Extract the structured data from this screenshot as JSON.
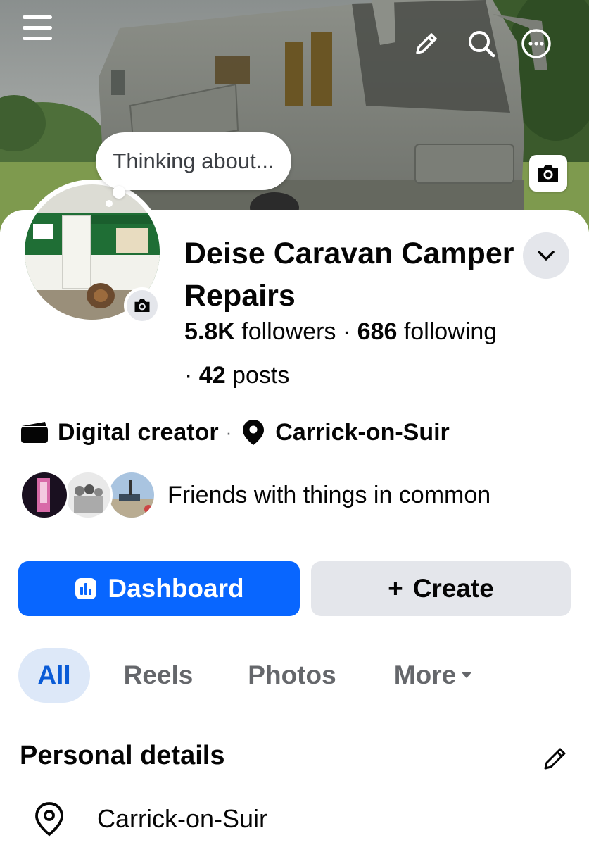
{
  "cover": {
    "thought_bubble": "Thinking about...",
    "icons": [
      "menu-icon",
      "pencil-icon",
      "search-icon",
      "more-icon",
      "camera-icon"
    ]
  },
  "profile": {
    "name": "Deise Caravan Camper Repairs",
    "followers_count": "5.8K",
    "followers_label": " followers · ",
    "following_count": "686",
    "following_label": " following",
    "posts_prefix": "· ",
    "posts_count": "42",
    "posts_label": " posts",
    "category": "Digital creator",
    "separator": "·",
    "location": "Carrick-on-Suir",
    "friends_text": "Friends with things in common"
  },
  "actions": {
    "dashboard_label": "Dashboard",
    "create_plus": "+",
    "create_label": "Create"
  },
  "tabs": [
    {
      "label": "All",
      "active": true
    },
    {
      "label": "Reels",
      "active": false
    },
    {
      "label": "Photos",
      "active": false
    },
    {
      "label": "More",
      "active": false
    }
  ],
  "personal_details": {
    "title": "Personal details",
    "items": [
      {
        "icon": "location-pin-icon",
        "text": "Carrick-on-Suir"
      }
    ]
  },
  "colors": {
    "accent": "#0866ff",
    "active_tab_bg": "#dde8f8",
    "active_tab_text": "#0a5bd6",
    "secondary_button": "#e4e6eb",
    "muted_text": "#65676b"
  }
}
